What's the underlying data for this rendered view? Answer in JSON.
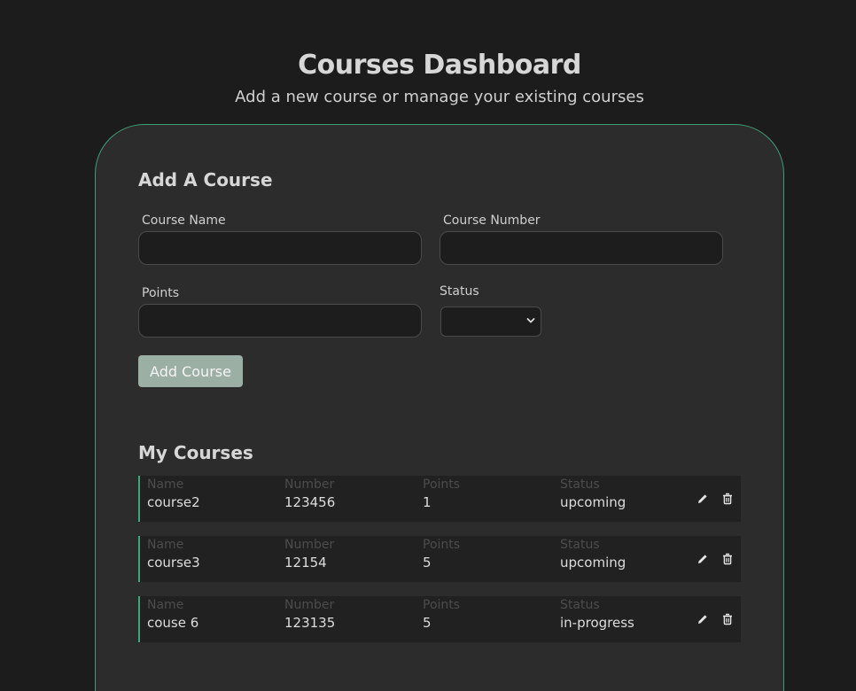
{
  "header": {
    "title": "Courses Dashboard",
    "subtitle": "Add a new course or manage your existing courses"
  },
  "add_course": {
    "title": "Add A Course",
    "fields": {
      "course_name": {
        "label": "Course Name",
        "value": ""
      },
      "course_number": {
        "label": "Course Number",
        "value": ""
      },
      "points": {
        "label": "Points",
        "value": ""
      },
      "status": {
        "label": "Status",
        "selected": ""
      }
    },
    "button_label": "Add Course"
  },
  "my_courses": {
    "title": "My Courses",
    "columns": [
      "Name",
      "Number",
      "Points",
      "Status"
    ],
    "rows": [
      {
        "name": "course2",
        "number": "123456",
        "points": "1",
        "status": "upcoming"
      },
      {
        "name": "course3",
        "number": "12154",
        "points": "5",
        "status": "upcoming"
      },
      {
        "name": "couse 6",
        "number": "123135",
        "points": "5",
        "status": "in-progress"
      }
    ]
  },
  "icons": {
    "edit": "pencil-icon",
    "delete": "trash-icon"
  },
  "colors": {
    "accent": "#3fa57c",
    "button": "#9cafa5",
    "background": "#1c1c1c",
    "card": "#2c2c2c"
  }
}
